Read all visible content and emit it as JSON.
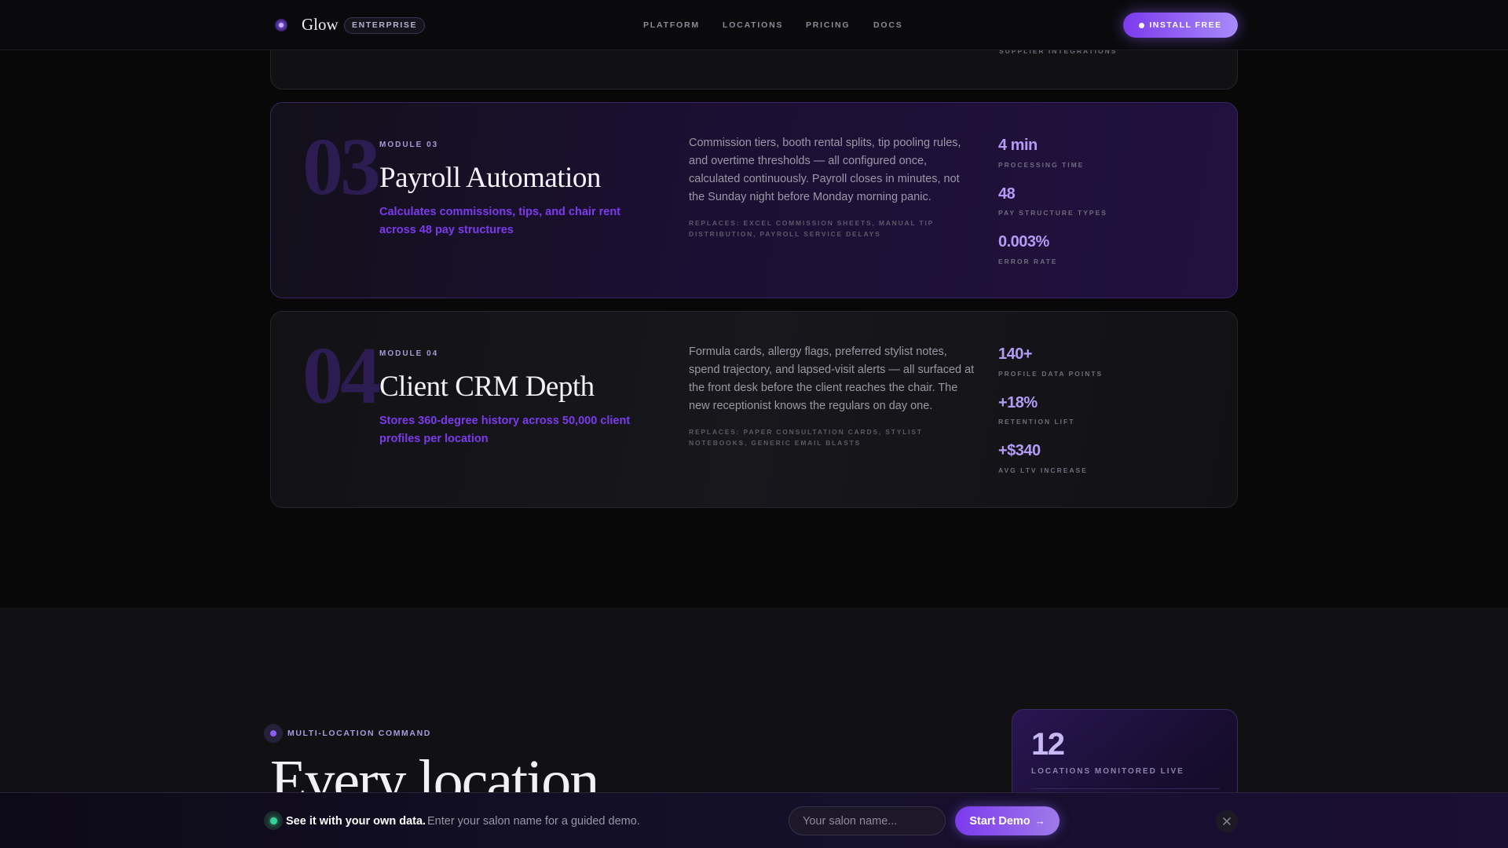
{
  "header": {
    "logo_icon": "glow-logo-icon",
    "logo_text": "Glow",
    "badge": "ENTERPRISE",
    "nav": [
      "PLATFORM",
      "LOCATIONS",
      "PRICING",
      "DOCS"
    ],
    "cta": "INSTALL FREE"
  },
  "previous_card": {
    "caption": "SUPPLIER INTEGRATIONS"
  },
  "modules": [
    {
      "number": "03",
      "label": "MODULE 03",
      "title": "Payroll Automation",
      "subtitle": "Calculates commissions, tips, and chair rent across 48 pay structures",
      "description": "Commission tiers, booth rental splits, tip pooling rules, and overtime thresholds — all configured once, calculated continuously. Payroll closes in minutes, not the Sunday night before Monday morning panic.",
      "replaces": "REPLACES: EXCEL COMMISSION SHEETS, MANUAL TIP DISTRIBUTION, PAYROLL SERVICE DELAYS",
      "stats": [
        {
          "value": "4 min",
          "label": "PROCESSING TIME"
        },
        {
          "value": "48",
          "label": "PAY STRUCTURE TYPES"
        },
        {
          "value": "0.003%",
          "label": "ERROR RATE"
        }
      ]
    },
    {
      "number": "04",
      "label": "MODULE 04",
      "title": "Client CRM Depth",
      "subtitle": "Stores 360-degree history across 50,000 client profiles per location",
      "description": "Formula cards, allergy flags, preferred stylist notes, spend trajectory, and lapsed-visit alerts — all surfaced at the front desk before the client reaches the chair. The new receptionist knows the regulars on day one.",
      "replaces": "REPLACES: PAPER CONSULTATION CARDS, STYLIST NOTEBOOKS, GENERIC EMAIL BLASTS",
      "stats": [
        {
          "value": "140+",
          "label": "PROFILE DATA POINTS"
        },
        {
          "value": "+18%",
          "label": "RETENTION LIFT"
        },
        {
          "value": "+$340",
          "label": "AVG LTV INCREASE"
        }
      ]
    }
  ],
  "multi_location": {
    "eyebrow": "MULTI-LOCATION COMMAND",
    "heading": "Every location",
    "stat_value": "12",
    "stat_label": "LOCATIONS MONITORED LIVE"
  },
  "demo_bar": {
    "strong": "See it with your own data.",
    "hint": "Enter your salon name for a guided demo.",
    "input_placeholder": "Your salon name...",
    "button": "Start Demo",
    "button_arrow": "→",
    "close_icon": "close-icon"
  },
  "colors": {
    "accent": "#7c3aed",
    "accent_light": "#a78bfa",
    "stat_value": "#b39cf5",
    "live_dot": "#34d399"
  }
}
